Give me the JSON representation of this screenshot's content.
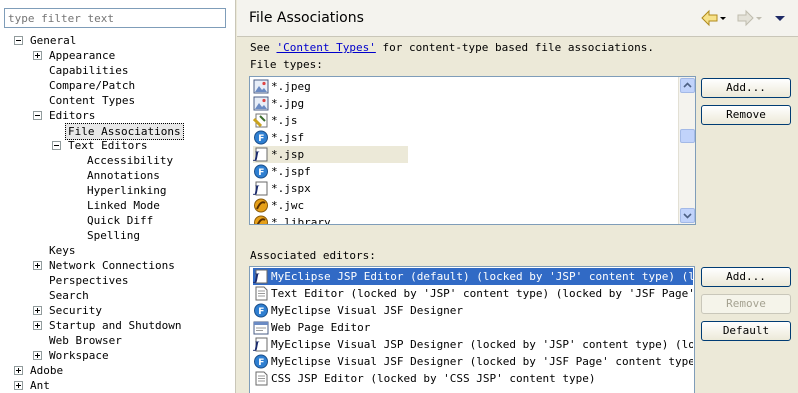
{
  "filter": {
    "placeholder": "type filter text"
  },
  "tree": {
    "items": [
      {
        "label": "General",
        "depth": 0,
        "toggle": "minus"
      },
      {
        "label": "Appearance",
        "depth": 1,
        "toggle": "plus"
      },
      {
        "label": "Capabilities",
        "depth": 1,
        "toggle": "none"
      },
      {
        "label": "Compare/Patch",
        "depth": 1,
        "toggle": "none"
      },
      {
        "label": "Content Types",
        "depth": 1,
        "toggle": "none"
      },
      {
        "label": "Editors",
        "depth": 1,
        "toggle": "minus"
      },
      {
        "label": "File Associations",
        "depth": 2,
        "toggle": "none",
        "selected": true
      },
      {
        "label": "Text Editors",
        "depth": 2,
        "toggle": "minus"
      },
      {
        "label": "Accessibility",
        "depth": 3,
        "toggle": "none"
      },
      {
        "label": "Annotations",
        "depth": 3,
        "toggle": "none"
      },
      {
        "label": "Hyperlinking",
        "depth": 3,
        "toggle": "none"
      },
      {
        "label": "Linked Mode",
        "depth": 3,
        "toggle": "none"
      },
      {
        "label": "Quick Diff",
        "depth": 3,
        "toggle": "none"
      },
      {
        "label": "Spelling",
        "depth": 3,
        "toggle": "none"
      },
      {
        "label": "Keys",
        "depth": 1,
        "toggle": "none"
      },
      {
        "label": "Network Connections",
        "depth": 1,
        "toggle": "plus"
      },
      {
        "label": "Perspectives",
        "depth": 1,
        "toggle": "none"
      },
      {
        "label": "Search",
        "depth": 1,
        "toggle": "none"
      },
      {
        "label": "Security",
        "depth": 1,
        "toggle": "plus"
      },
      {
        "label": "Startup and Shutdown",
        "depth": 1,
        "toggle": "plus"
      },
      {
        "label": "Web Browser",
        "depth": 1,
        "toggle": "none"
      },
      {
        "label": "Workspace",
        "depth": 1,
        "toggle": "plus"
      },
      {
        "label": "Adobe",
        "depth": 0,
        "toggle": "plus"
      },
      {
        "label": "Ant",
        "depth": 0,
        "toggle": "plus"
      }
    ]
  },
  "header": {
    "title": "File Associations"
  },
  "description": {
    "prefix": "See ",
    "link": "'Content Types'",
    "suffix": " for content-type based file associations."
  },
  "file_types": {
    "label": "File types:",
    "items": [
      {
        "text": "*.jpeg",
        "icon": "image-icon"
      },
      {
        "text": "*.jpg",
        "icon": "image-icon"
      },
      {
        "text": "*.js",
        "icon": "javascript-icon"
      },
      {
        "text": "*.jsf",
        "icon": "jsf-icon"
      },
      {
        "text": "*.jsp",
        "icon": "jsp-icon",
        "selected": true
      },
      {
        "text": "*.jspf",
        "icon": "jsf-icon"
      },
      {
        "text": "*.jspx",
        "icon": "jsp-icon"
      },
      {
        "text": "*.jwc",
        "icon": "tapestry-icon"
      },
      {
        "text": "*.library",
        "icon": "tapestry-icon"
      }
    ]
  },
  "file_type_buttons": {
    "add": "Add...",
    "remove": "Remove"
  },
  "editors": {
    "label": "Associated editors:",
    "items": [
      {
        "text": "MyEclipse JSP Editor (default) (locked by 'JSP' content type) (locked",
        "icon": "jsp-icon",
        "selected": true
      },
      {
        "text": "Text Editor (locked by 'JSP' content type) (locked by 'JSF Page' conte",
        "icon": "text-file-icon"
      },
      {
        "text": "MyEclipse Visual JSF Designer",
        "icon": "jsf-icon"
      },
      {
        "text": "Web Page Editor",
        "icon": "web-page-icon"
      },
      {
        "text": "MyEclipse Visual JSP Designer (locked by 'JSP' content type) (locked b",
        "icon": "jsp-icon"
      },
      {
        "text": "MyEclipse Visual JSF Designer (locked by 'JSF Page' content type)",
        "icon": "jsf-icon"
      },
      {
        "text": "CSS JSP Editor (locked by 'CSS JSP' content type)",
        "icon": "text-file-icon"
      }
    ]
  },
  "editor_buttons": {
    "add": "Add...",
    "remove": "Remove",
    "default": "Default"
  },
  "colors": {
    "selection": "#316ac5",
    "background": "#ece9d8",
    "link": "#0000cc"
  }
}
